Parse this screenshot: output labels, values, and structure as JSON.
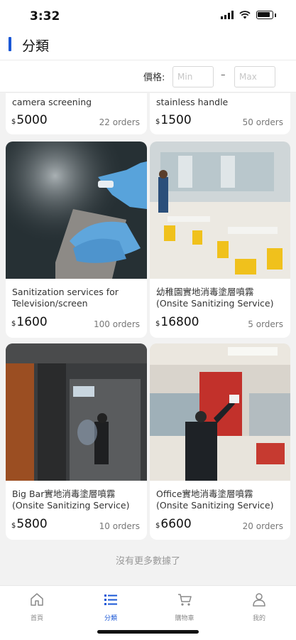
{
  "status_bar": {
    "time": "3:32",
    "icons": [
      "signal-icon",
      "wifi-icon",
      "battery-icon"
    ]
  },
  "header": {
    "title": "分類",
    "accent_color": "#1a57d6"
  },
  "filter": {
    "price_label": "價格:",
    "min_placeholder": "Min",
    "max_placeholder": "Max",
    "dash": "–"
  },
  "products": [
    {
      "title": "camera screening",
      "currency": "$",
      "price": "5000",
      "orders": "22 orders"
    },
    {
      "title": "stainless handle",
      "currency": "$",
      "price": "1500",
      "orders": "50 orders"
    },
    {
      "title": "Sanitization services for Television/screen",
      "currency": "$",
      "price": "1600",
      "orders": "100 orders"
    },
    {
      "title": "幼稚園實地消毒塗層噴霧 (Onsite Sanitizing Service)",
      "currency": "$",
      "price": "16800",
      "orders": "5 orders"
    },
    {
      "title": "Big Bar實地消毒塗層噴霧 (Onsite Sanitizing Service)",
      "currency": "$",
      "price": "5800",
      "orders": "10 orders"
    },
    {
      "title": "Office實地消毒塗層噴霧 (Onsite Sanitizing Service)",
      "currency": "$",
      "price": "6600",
      "orders": "20 orders"
    }
  ],
  "list_end_text": "沒有更多數據了",
  "tabbar": {
    "items": [
      {
        "label": "首頁",
        "icon": "home-icon",
        "active": false
      },
      {
        "label": "分類",
        "icon": "list-icon",
        "active": true
      },
      {
        "label": "購物車",
        "icon": "cart-icon",
        "active": false
      },
      {
        "label": "我的",
        "icon": "person-icon",
        "active": false
      }
    ]
  }
}
